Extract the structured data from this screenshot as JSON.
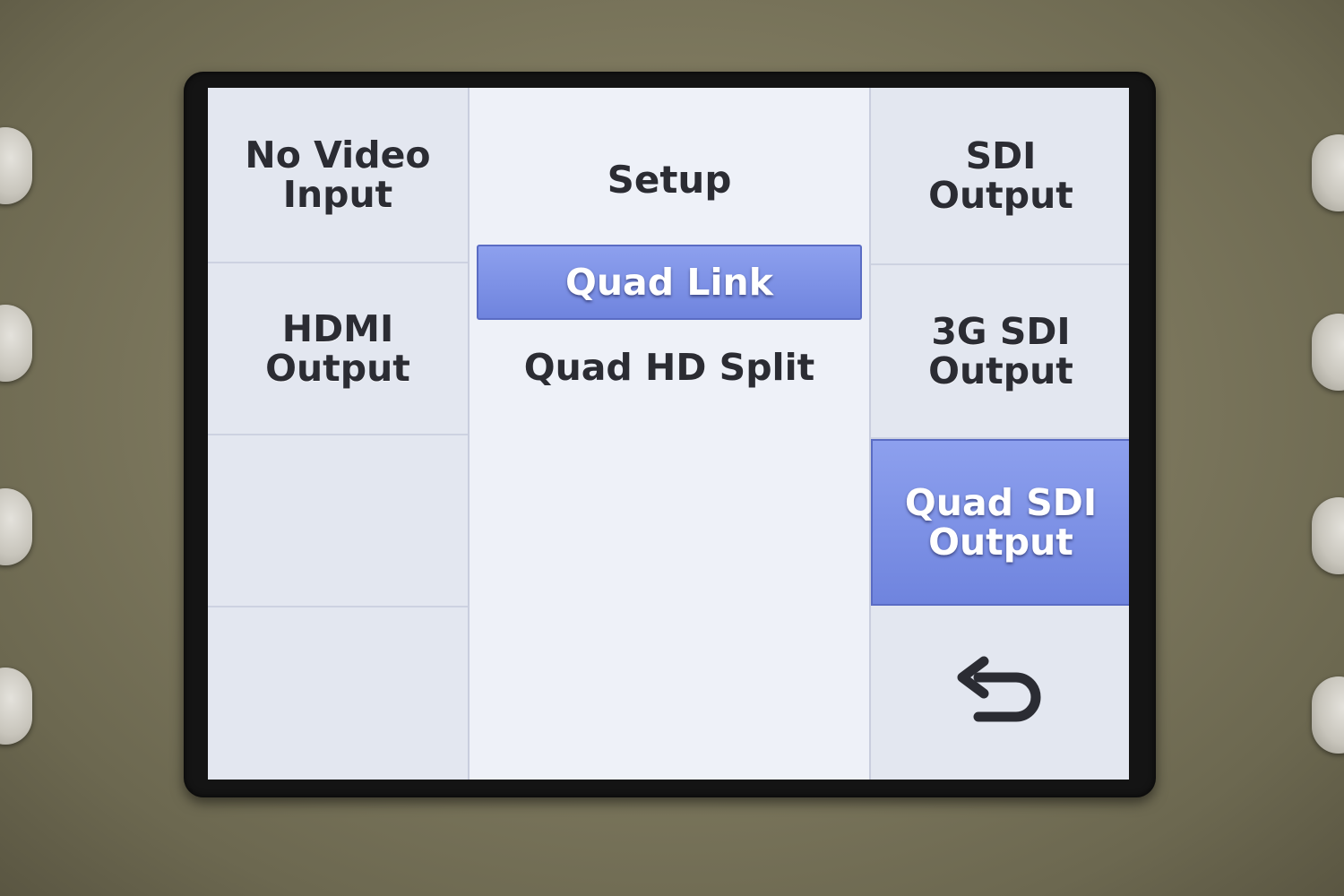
{
  "left_column": {
    "items": [
      {
        "label": "No Video\nInput"
      },
      {
        "label": "HDMI\nOutput"
      },
      {
        "label": ""
      },
      {
        "label": ""
      }
    ]
  },
  "middle_column": {
    "title": "Setup",
    "options": [
      {
        "label": "Quad Link",
        "selected": true
      },
      {
        "label": "Quad HD Split",
        "selected": false
      }
    ]
  },
  "right_column": {
    "items": [
      {
        "label": "SDI\nOutput",
        "selected": false
      },
      {
        "label": "3G SDI\nOutput",
        "selected": false
      },
      {
        "label": "Quad SDI\nOutput",
        "selected": true
      }
    ],
    "back_icon": "back-arrow-icon"
  },
  "colors": {
    "highlight": "#7b8fe6",
    "panel": "#e3e7f0",
    "text": "#2b2c33"
  }
}
